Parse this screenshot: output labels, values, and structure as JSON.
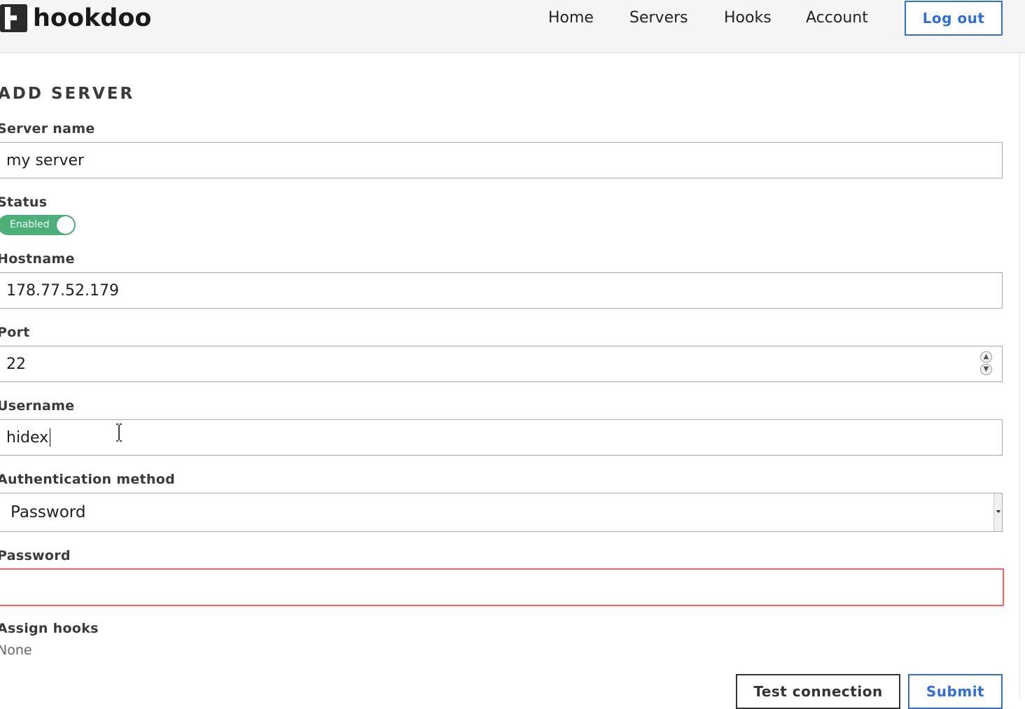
{
  "header": {
    "brand": "hookdoo",
    "nav": [
      {
        "label": "Home"
      },
      {
        "label": "Servers"
      },
      {
        "label": "Hooks"
      },
      {
        "label": "Account"
      }
    ],
    "logout_label": "Log out"
  },
  "form": {
    "title": "ADD SERVER",
    "server_name": {
      "label": "Server name",
      "value": "my server"
    },
    "status": {
      "label": "Status",
      "toggle_text": "Enabled",
      "enabled": true
    },
    "hostname": {
      "label": "Hostname",
      "value": "178.77.52.179"
    },
    "port": {
      "label": "Port",
      "value": "22"
    },
    "username": {
      "label": "Username",
      "value": "hidex"
    },
    "auth_method": {
      "label": "Authentication method",
      "selected": "Password"
    },
    "password": {
      "label": "Password",
      "value": ""
    },
    "assign_hooks": {
      "label": "Assign hooks",
      "value": "None"
    }
  },
  "actions": {
    "test_label": "Test connection",
    "submit_label": "Submit"
  },
  "colors": {
    "accent": "#2f6fd6",
    "toggle_on": "#4caf78",
    "error_border": "#e06d6d"
  }
}
